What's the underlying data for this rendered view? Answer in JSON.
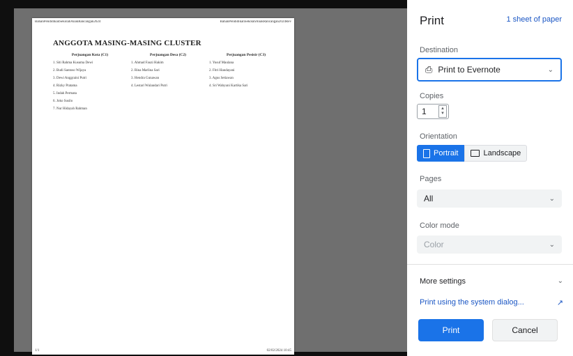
{
  "preview": {
    "header_left": "BahanPendidikanSekolahAnakRancangan2024",
    "header_right": "BahanPendidikanSekolahAnakRancangan2024Rev",
    "doc_title": "ANGGOTA MASING-MASING CLUSTER",
    "clusters": [
      {
        "heading": "Perjuangan Kota (C1)",
        "members": [
          "1. Siti Rahma Kusuma Dewi",
          "2. Budi Santoso Wijaya",
          "3. Dewi Anggraini Putri",
          "4. Rizky Pratama",
          "5. Indah Permata",
          "6. Joko Susilo",
          "7. Nur Hidayah Rahman"
        ]
      },
      {
        "heading": "Perjuangan Desa (C2)",
        "members": [
          "1. Ahmad Fauzi Hakim",
          "2. Rina Marlina Sari",
          "3. Hendra Gunawan",
          "4. Lestari Wulandari Putri"
        ]
      },
      {
        "heading": "Perjuangan Pesisir (C3)",
        "members": [
          "1. Yusuf Maulana",
          "2. Fitri Handayani",
          "3. Agus Setiawan",
          "4. Sri Wahyuni Kartika Sari"
        ]
      }
    ],
    "footer_left": "1/1",
    "footer_right": "02/02/2024 10:45"
  },
  "panel": {
    "title": "Print",
    "sheet_count": "1 sheet of paper",
    "destination_label": "Destination",
    "destination_value": "Print to Evernote",
    "copies_label": "Copies",
    "copies_value": "1",
    "orientation_label": "Orientation",
    "portrait_label": "Portrait",
    "landscape_label": "Landscape",
    "pages_label": "Pages",
    "pages_value": "All",
    "color_mode_label": "Color mode",
    "color_mode_value": "Color",
    "more_settings_label": "More settings",
    "system_dialog_label": "Print using the system dialog...",
    "print_button": "Print",
    "cancel_button": "Cancel"
  },
  "colors": {
    "accent": "#1a73e8",
    "link": "#1a56c4",
    "preview_bg": "#6f6f6f"
  }
}
